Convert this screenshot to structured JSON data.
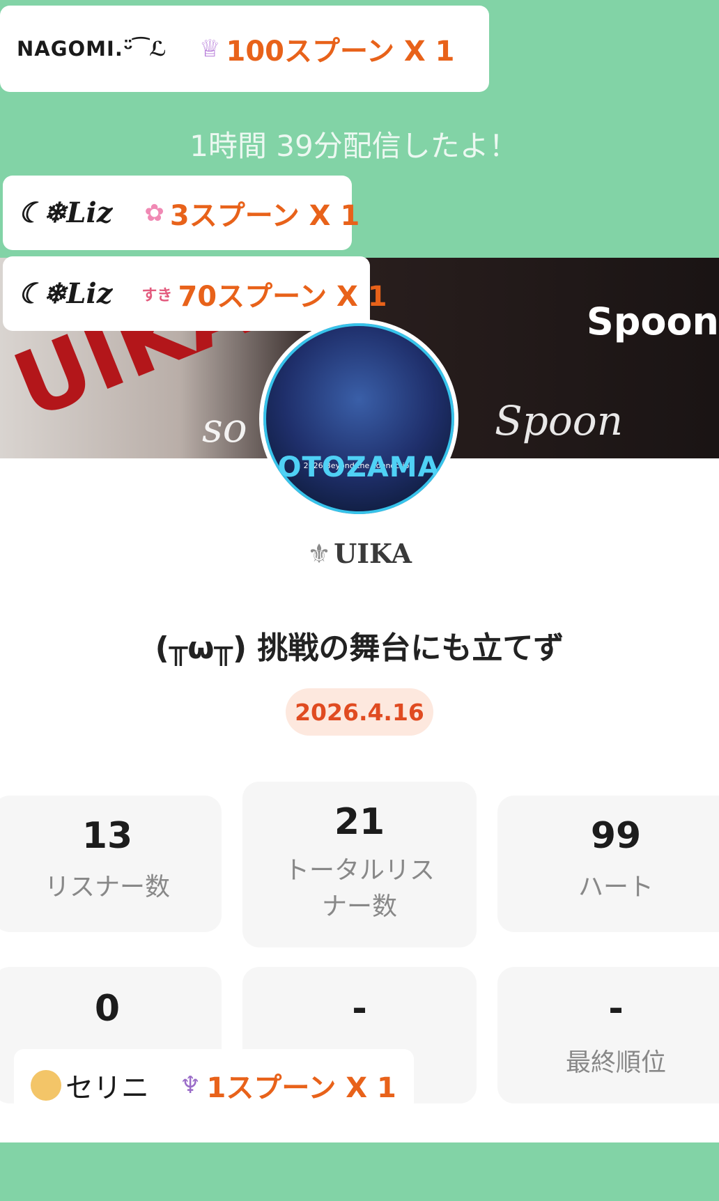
{
  "duration_text": "1時間 39分配信したよ！",
  "gift_notices": [
    {
      "sender": "NAGOMI.ᵕ̈ ͡ ℒ",
      "gift_icon": "crown-icon",
      "gift_glyph": "♕",
      "gift_text": "100スプーン X 1"
    },
    {
      "sender": "☾❄Liz",
      "gift_icon": "flower-icon",
      "gift_glyph": "✿",
      "gift_text": "3スプーン X 1"
    },
    {
      "sender": "☾❄Liz",
      "gift_icon": "suki-hearts-icon",
      "gift_glyph": "すき",
      "gift_text": "70スプーン X 1"
    },
    {
      "sender": "セリニ",
      "gift_icon": "parfait-icon",
      "gift_glyph": "♆",
      "gift_text": "1スプーン X 1"
    }
  ],
  "banner": {
    "name_text": "UIKA",
    "brand": "Spoon",
    "script_left": "so",
    "script_right": "Spoon"
  },
  "avatar": {
    "label": "OTOZAMA",
    "sub": "2026 Beyond the connection"
  },
  "profile": {
    "fleur_glyph": "⚜",
    "name": "UIKA"
  },
  "broadcast": {
    "title": "(╥ω╥) 挑戦の舞台にも立てず",
    "date": "2026.4.16"
  },
  "stats": [
    {
      "value": "13",
      "label": "リスナー数"
    },
    {
      "value": "21",
      "label": "トータルリスナー数"
    },
    {
      "value": "99",
      "label": "ハート"
    },
    {
      "value": "0",
      "label": ""
    },
    {
      "value": "-",
      "label": ""
    },
    {
      "value": "-",
      "label": "最終順位"
    }
  ],
  "colors": {
    "background_green": "#82d3a6",
    "gift_orange": "#e8621a",
    "date_text": "#e04b21",
    "date_bg": "#fde8de"
  }
}
